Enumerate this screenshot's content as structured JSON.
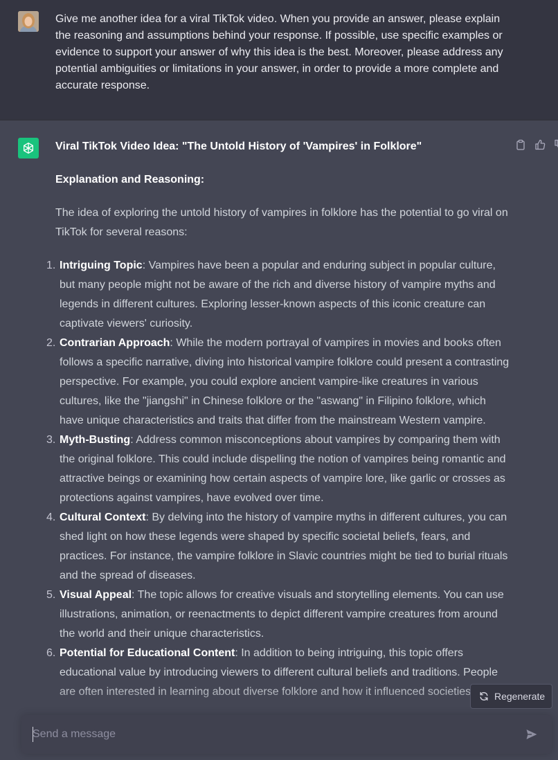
{
  "user_message": {
    "text": "Give me another idea for a viral TikTok video. When you provide an answer, please explain the reasoning and assumptions behind your response. If possible, use specific examples or evidence to support your answer of why this idea is the best. Moreover, please address any potential ambiguities or limitations in your answer, in order to provide a more complete and accurate response."
  },
  "assistant_message": {
    "title": "Viral TikTok Video Idea: \"The Untold History of 'Vampires' in Folklore\"",
    "section_heading": "Explanation and Reasoning:",
    "intro": "The idea of exploring the untold history of vampires in folklore has the potential to go viral on TikTok for several reasons:",
    "points": [
      {
        "num": "1.",
        "heading": "Intriguing Topic",
        "text": ": Vampires have been a popular and enduring subject in popular culture, but many people might not be aware of the rich and diverse history of vampire myths and legends in different cultures. Exploring lesser-known aspects of this iconic creature can captivate viewers' curiosity."
      },
      {
        "num": "2.",
        "heading": "Contrarian Approach",
        "text": ": While the modern portrayal of vampires in movies and books often follows a specific narrative, diving into historical vampire folklore could present a contrasting perspective. For example, you could explore ancient vampire-like creatures in various cultures, like the \"jiangshi\" in Chinese folklore or the \"aswang\" in Filipino folklore, which have unique characteristics and traits that differ from the mainstream Western vampire."
      },
      {
        "num": "3.",
        "heading": "Myth-Busting",
        "text": ": Address common misconceptions about vampires by comparing them with the original folklore. This could include dispelling the notion of vampires being romantic and attractive beings or examining how certain aspects of vampire lore, like garlic or crosses as protections against vampires, have evolved over time."
      },
      {
        "num": "4.",
        "heading": "Cultural Context",
        "text": ": By delving into the history of vampire myths in different cultures, you can shed light on how these legends were shaped by specific societal beliefs, fears, and practices. For instance, the vampire folklore in Slavic countries might be tied to burial rituals and the spread of diseases."
      },
      {
        "num": "5.",
        "heading": "Visual Appeal",
        "text": ": The topic allows for creative visuals and storytelling elements. You can use illustrations, animation, or reenactments to depict different vampire creatures from around the world and their unique characteristics."
      },
      {
        "num": "6.",
        "heading": "Potential for Educational Content",
        "text": ": In addition to being intriguing, this topic offers educational value by introducing viewers to different cultural beliefs and traditions. People are often interested in learning about diverse folklore and how it influenced societies."
      }
    ]
  },
  "controls": {
    "regenerate_label": "Regenerate",
    "input_placeholder": "Send a message"
  },
  "colors": {
    "user_bg": "#343541",
    "assistant_bg": "#444654",
    "gpt_brand": "#19c37d",
    "input_bg": "#40414f"
  }
}
